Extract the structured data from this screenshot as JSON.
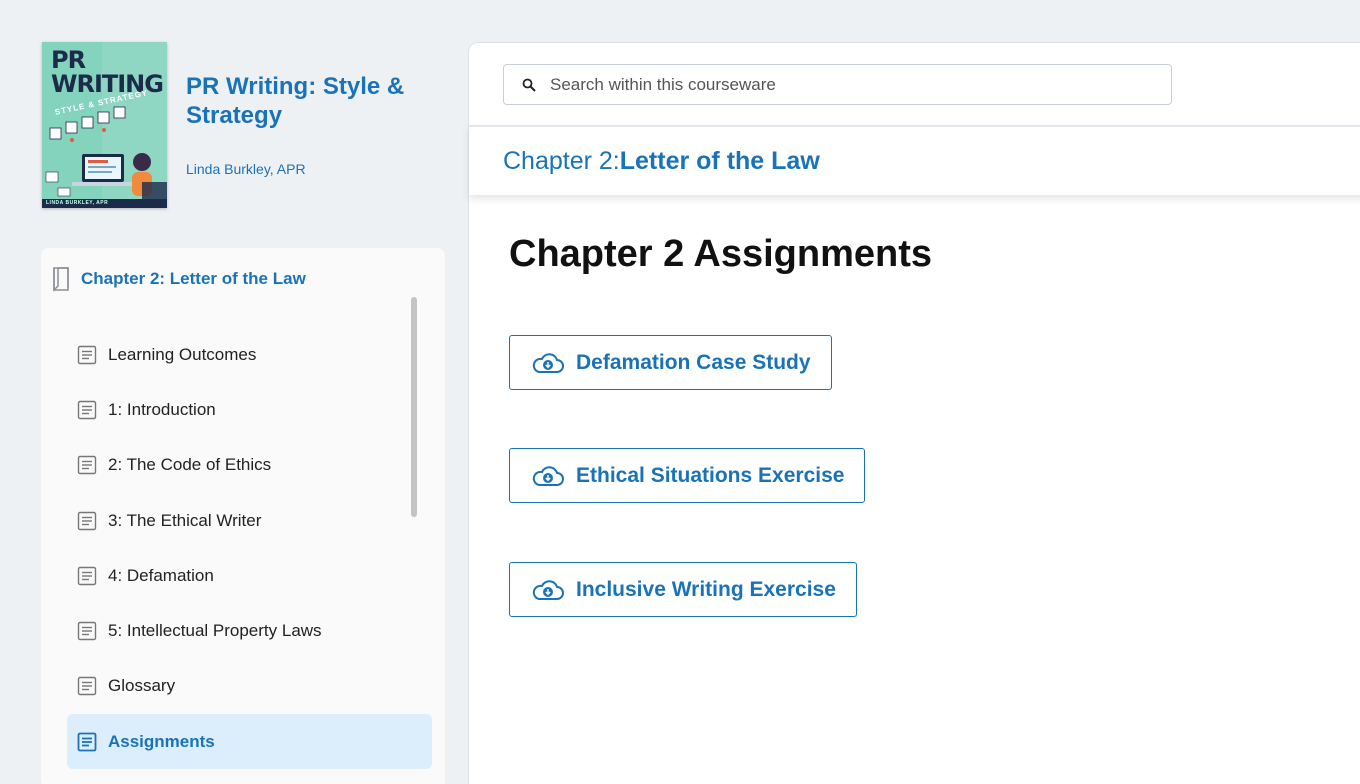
{
  "book": {
    "cover_title_line1": "PR",
    "cover_title_line2": "WRITING",
    "cover_subtitle": "STYLE & STRATEGY",
    "cover_author": "LINDA BURKLEY, APR",
    "title": "PR Writing: Style & Strategy",
    "author": "Linda Burkley, APR"
  },
  "toc": {
    "chapter_label": "Chapter 2: Letter of the Law",
    "items": [
      {
        "label": "Learning Outcomes"
      },
      {
        "label": "1: Introduction"
      },
      {
        "label": "2: The Code of Ethics"
      },
      {
        "label": "3: The Ethical Writer"
      },
      {
        "label": "4: Defamation"
      },
      {
        "label": "5: Intellectual Property Laws"
      },
      {
        "label": "Glossary"
      },
      {
        "label": "Assignments",
        "active": true
      }
    ]
  },
  "search": {
    "placeholder": "Search within this courseware"
  },
  "chapter_bar": {
    "prefix": "Chapter 2: ",
    "title": "Letter of the Law"
  },
  "main": {
    "heading": "Chapter 2 Assignments",
    "assignments": [
      {
        "label": "Defamation Case Study"
      },
      {
        "label": "Ethical Situations Exercise"
      },
      {
        "label": "Inclusive Writing Exercise"
      }
    ]
  },
  "colors": {
    "accent": "#1a73b8",
    "active_bg": "#dcedfb",
    "page_bg": "#eef1f4"
  },
  "icons": {
    "collapse": "collapse-sidebar-icon",
    "chapter": "bookmark-icon",
    "toc_item": "document-icon",
    "search": "search-icon",
    "assignment": "cloud-download-icon"
  }
}
